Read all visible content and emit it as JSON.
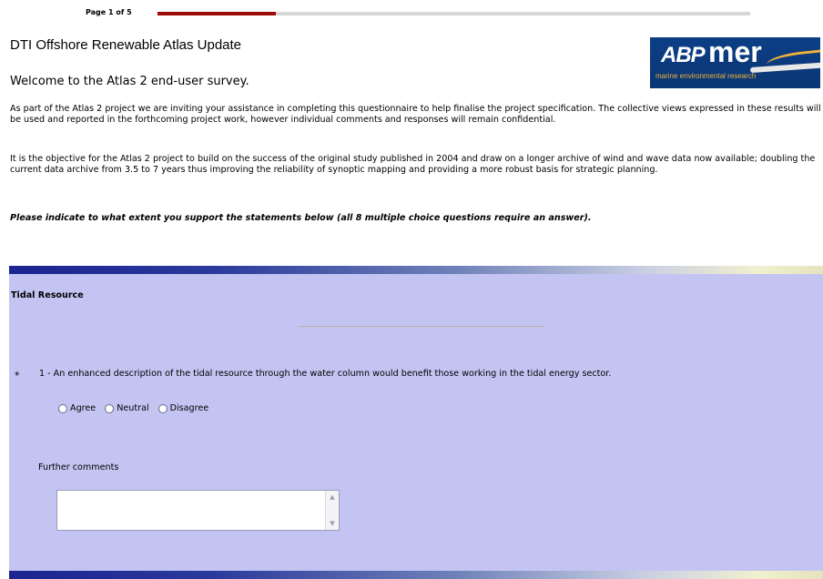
{
  "progress": {
    "label": "Page 1 of 5",
    "fraction": 0.2
  },
  "header": {
    "title": "DTI Offshore Renewable Atlas Update",
    "subtitle": "Welcome to the Atlas 2 end-user survey."
  },
  "logo": {
    "brand_prefix": "ABP",
    "brand_name": "mer",
    "tagline": "marine environmental research"
  },
  "intro": {
    "paragraph1": "As part of the Atlas 2 project we are inviting your assistance in completing this questionnaire to help finalise the project specification. The collective views expressed in these results will be used and reported in the forthcoming project work, however individual comments and responses will remain confidential.",
    "paragraph2": "It is the objective for the Atlas 2 project to build on the success of the original study published in 2004 and draw on a longer archive of wind and wave data now available; doubling the current data archive from 3.5 to 7 years thus improving the reliability of synoptic mapping and providing a more robust basis for strategic planning.",
    "instruction": "Please indicate to what extent you support the statements below (all 8 multiple choice questions require an answer)."
  },
  "section": {
    "title": "Tidal Resource",
    "question": {
      "required_marker": "*",
      "text": "1 - An enhanced description of the tidal resource through the water column would benefit those working in the tidal energy sector.",
      "options": [
        "Agree",
        "Neutral",
        "Disagree"
      ],
      "comments_label": "Further comments",
      "comments_value": ""
    }
  },
  "colors": {
    "panel_bg": "#c4c4f3",
    "progress_fill": "#9e0a0a",
    "logo_bg": "#0c3f86"
  }
}
